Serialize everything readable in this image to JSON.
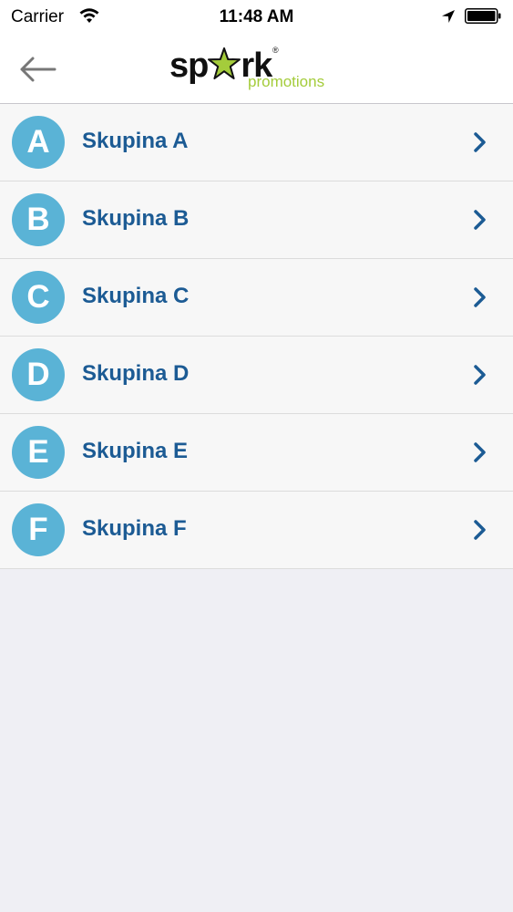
{
  "statusbar": {
    "carrier": "Carrier",
    "time": "11:48 AM"
  },
  "navbar": {
    "logo_main_left": "sp",
    "logo_main_right": "rk",
    "logo_sub": "promotions",
    "logo_reg": "®"
  },
  "colors": {
    "badge": "#5ab3d6",
    "label": "#1c5b94",
    "logo_green": "#a4cc3b"
  },
  "groups": [
    {
      "letter": "A",
      "label": "Skupina A"
    },
    {
      "letter": "B",
      "label": "Skupina B"
    },
    {
      "letter": "C",
      "label": "Skupina C"
    },
    {
      "letter": "D",
      "label": "Skupina D"
    },
    {
      "letter": "E",
      "label": "Skupina E"
    },
    {
      "letter": "F",
      "label": "Skupina F"
    }
  ]
}
